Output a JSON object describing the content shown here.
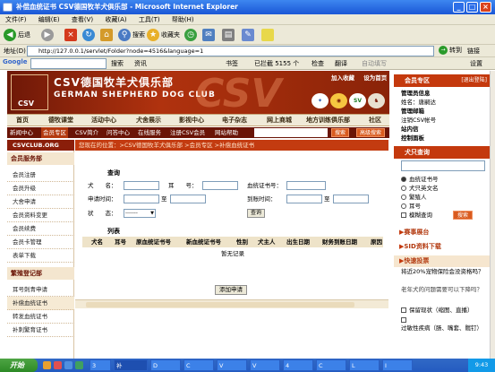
{
  "window": {
    "title": "补偿血统证书 CSV德国牧羊犬俱乐部 - Microsoft Internet Explorer"
  },
  "menu": [
    "文件(F)",
    "编辑(E)",
    "查看(V)",
    "收藏(A)",
    "工具(T)",
    "帮助(H)"
  ],
  "toolbar": {
    "back": "后退",
    "search": "搜索",
    "favorites": "收藏夹",
    "go": "转到",
    "links": "链接"
  },
  "address": {
    "label": "地址(D)",
    "url": "http://127.0.0.1/servlet/Folder?node=4516&language=1"
  },
  "googlebar": {
    "label": "Google",
    "search": "搜索",
    "news": "资讯",
    "bookmarks": "书签",
    "blocked": "已拦截 5155 个",
    "check": "检查",
    "translate": "翻译",
    "fill": "自动填写",
    "settings": "设置"
  },
  "site": {
    "brand_cn": "CSV德国牧羊犬俱乐部",
    "brand_en": "GERMAN SHEPHERD DOG CLUB",
    "logo_text": "CSV",
    "header_links": [
      "加入收藏",
      "设为首页"
    ]
  },
  "nav_main": [
    "首页",
    "德牧课堂",
    "活动中心",
    "犬舍展示",
    "影视中心",
    "电子杂志",
    "网上商城",
    "地方训练俱乐部",
    "社区"
  ],
  "nav_sub": [
    "新闻中心",
    "会员专区",
    "CSV简介",
    "问答中心",
    "在线服务",
    "注册CSV会员",
    "网站帮助"
  ],
  "nav_sub_buttons": [
    "搜索",
    "高级搜索"
  ],
  "sidebar": {
    "header": "CSVCLUB.ORG",
    "section1": "会员服务部",
    "items1": [
      "会员注册",
      "会员升级",
      "大舍申请",
      "会员资料变更",
      "会员续费",
      "会员卡管理",
      "表单下载"
    ],
    "section2": "繁殖登记部",
    "items2": [
      "耳号刺青申请",
      "补偿血统证书",
      "转发血统证书",
      "补刺繁育证书"
    ]
  },
  "breadcrumb": "您现在的位置：>CSV德国牧羊犬俱乐部 >会员专区 >补偿血统证书",
  "query": {
    "title": "查询",
    "name": "犬　　名：",
    "ear": "耳　　号：",
    "cert": "血统证书号：",
    "apply_time": "申请时间：",
    "to1": "至",
    "arrive_time": "到账时间：",
    "to2": "至",
    "status": "状　　态：",
    "status_value": "-------",
    "btn": "查询"
  },
  "list": {
    "label": "列表",
    "headers": [
      "犬名",
      "耳号",
      "原血统证书号",
      "新血统证书号",
      "性别",
      "犬主人",
      "出生日期",
      "财务到账日期",
      "原因"
    ],
    "empty": "暂无记录",
    "add": "添加申请"
  },
  "rpanel": {
    "member_head": "会员专区",
    "logout": "[退出登陆]",
    "member_items": [
      "管理员信息",
      "姓名：唐嗣达",
      "管理邮箱",
      "注销CSV帐号",
      "站内信",
      "控制面板"
    ],
    "search_head": "犬只查询",
    "search_options": [
      "血统证书号",
      "犬只英文名",
      "繁殖人",
      "耳号",
      "模糊查询"
    ],
    "search_btn": "搜索",
    "sub1": "赛事展台",
    "sub2": "SID资料下载",
    "vote_head": "快速投票",
    "vote_q": "将近20%宠物保险会没资格吗？",
    "vote_q2": "老年犬的问题需要可以下降吗？",
    "vote_opts": [
      "保留现状（缩图、直播）",
      "过敏性疾病（肠、嘴套、髋钉）"
    ]
  },
  "taskbar": {
    "start": "开始",
    "tasks": [
      "3",
      "补",
      "D",
      "C",
      "V",
      "V",
      "4",
      "C",
      "L",
      "I"
    ],
    "clock": "9:43"
  },
  "colors": {
    "brand_red": "#8a1e0a",
    "accent_orange": "#c4390d",
    "ie_blue": "#245bc0"
  }
}
